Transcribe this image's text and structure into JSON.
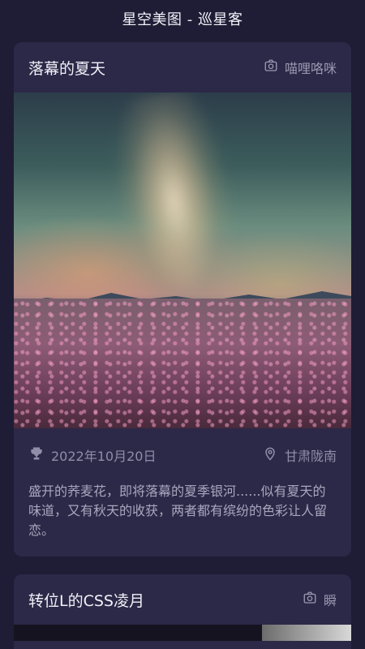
{
  "app": {
    "title": "星空美图 - 巡星客"
  },
  "cards": [
    {
      "title": "落幕的夏天",
      "author": "喵哩咯咪",
      "date": "2022年10月20日",
      "location": "甘肃陇南",
      "description": "盛开的荞麦花，即将落幕的夏季银河......似有夏天的味道，又有秋天的收获，两者都有缤纷的色彩让人留恋。"
    },
    {
      "title": "转位L的CSS凌月",
      "author": "瞬"
    }
  ],
  "icons": {
    "camera": "camera-icon",
    "trophy": "trophy-icon",
    "location": "location-pin-icon"
  },
  "colors": {
    "background": "#1f1d35",
    "card": "#2b2947",
    "muted_text": "#8f8da8"
  }
}
